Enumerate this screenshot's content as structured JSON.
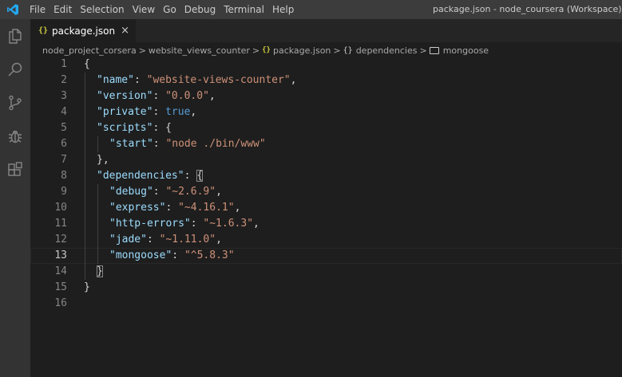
{
  "menu": [
    "File",
    "Edit",
    "Selection",
    "View",
    "Go",
    "Debug",
    "Terminal",
    "Help"
  ],
  "window_title": "package.json - node_coursera (Workspace) - Visual St",
  "tab": {
    "icon_text": "{}",
    "label": "package.json",
    "close_glyph": "×"
  },
  "breadcrumb": {
    "items": [
      "node_project_corsera",
      "website_views_counter",
      "package.json",
      "dependencies",
      "mongoose"
    ],
    "separator": ">",
    "json_icon_text": "{}",
    "object_icon_text": "{}"
  },
  "editor": {
    "active_line": 13,
    "lines": [
      {
        "number": "1",
        "indent": 0,
        "tokens": [
          {
            "t": "p",
            "v": "{"
          }
        ]
      },
      {
        "number": "2",
        "indent": 1,
        "tokens": [
          {
            "t": "k",
            "v": "\"name\""
          },
          {
            "t": "p",
            "v": ": "
          },
          {
            "t": "s",
            "v": "\"website-views-counter\""
          },
          {
            "t": "p",
            "v": ","
          }
        ]
      },
      {
        "number": "3",
        "indent": 1,
        "tokens": [
          {
            "t": "k",
            "v": "\"version\""
          },
          {
            "t": "p",
            "v": ": "
          },
          {
            "t": "s",
            "v": "\"0.0.0\""
          },
          {
            "t": "p",
            "v": ","
          }
        ]
      },
      {
        "number": "4",
        "indent": 1,
        "tokens": [
          {
            "t": "k",
            "v": "\"private\""
          },
          {
            "t": "p",
            "v": ": "
          },
          {
            "t": "b",
            "v": "true"
          },
          {
            "t": "p",
            "v": ","
          }
        ]
      },
      {
        "number": "5",
        "indent": 1,
        "tokens": [
          {
            "t": "k",
            "v": "\"scripts\""
          },
          {
            "t": "p",
            "v": ": {"
          }
        ]
      },
      {
        "number": "6",
        "indent": 2,
        "tokens": [
          {
            "t": "k",
            "v": "\"start\""
          },
          {
            "t": "p",
            "v": ": "
          },
          {
            "t": "s",
            "v": "\"node ./bin/www\""
          }
        ]
      },
      {
        "number": "7",
        "indent": 1,
        "tokens": [
          {
            "t": "p",
            "v": "},"
          }
        ]
      },
      {
        "number": "8",
        "indent": 1,
        "tokens": [
          {
            "t": "k",
            "v": "\"dependencies\""
          },
          {
            "t": "p",
            "v": ": "
          },
          {
            "t": "p",
            "v": "{",
            "m": true
          }
        ]
      },
      {
        "number": "9",
        "indent": 2,
        "tokens": [
          {
            "t": "k",
            "v": "\"debug\""
          },
          {
            "t": "p",
            "v": ": "
          },
          {
            "t": "s",
            "v": "\"~2.6.9\""
          },
          {
            "t": "p",
            "v": ","
          }
        ]
      },
      {
        "number": "10",
        "indent": 2,
        "tokens": [
          {
            "t": "k",
            "v": "\"express\""
          },
          {
            "t": "p",
            "v": ": "
          },
          {
            "t": "s",
            "v": "\"~4.16.1\""
          },
          {
            "t": "p",
            "v": ","
          }
        ]
      },
      {
        "number": "11",
        "indent": 2,
        "tokens": [
          {
            "t": "k",
            "v": "\"http-errors\""
          },
          {
            "t": "p",
            "v": ": "
          },
          {
            "t": "s",
            "v": "\"~1.6.3\""
          },
          {
            "t": "p",
            "v": ","
          }
        ]
      },
      {
        "number": "12",
        "indent": 2,
        "tokens": [
          {
            "t": "k",
            "v": "\"jade\""
          },
          {
            "t": "p",
            "v": ": "
          },
          {
            "t": "s",
            "v": "\"~1.11.0\""
          },
          {
            "t": "p",
            "v": ","
          }
        ]
      },
      {
        "number": "13",
        "indent": 2,
        "tokens": [
          {
            "t": "k",
            "v": "\"mongoose\""
          },
          {
            "t": "p",
            "v": ": "
          },
          {
            "t": "s",
            "v": "\"^5.8.3\""
          }
        ]
      },
      {
        "number": "14",
        "indent": 1,
        "tokens": [
          {
            "t": "p",
            "v": "}",
            "m": true
          }
        ]
      },
      {
        "number": "15",
        "indent": 0,
        "tokens": [
          {
            "t": "p",
            "v": "}"
          }
        ]
      },
      {
        "number": "16",
        "indent": 0,
        "tokens": []
      }
    ]
  },
  "colors": {
    "title_bar": "#3c3c3c",
    "activity_bar": "#333333",
    "editor_bg": "#1e1e1e",
    "tab_bar": "#252526",
    "vscode_blue": "#23a9f2",
    "json_key": "#9cdcfe",
    "json_string": "#ce9178",
    "json_boolean": "#569cd6"
  },
  "activity_icons": [
    "explorer-icon",
    "search-icon",
    "source-control-icon",
    "debug-icon",
    "extensions-icon"
  ]
}
